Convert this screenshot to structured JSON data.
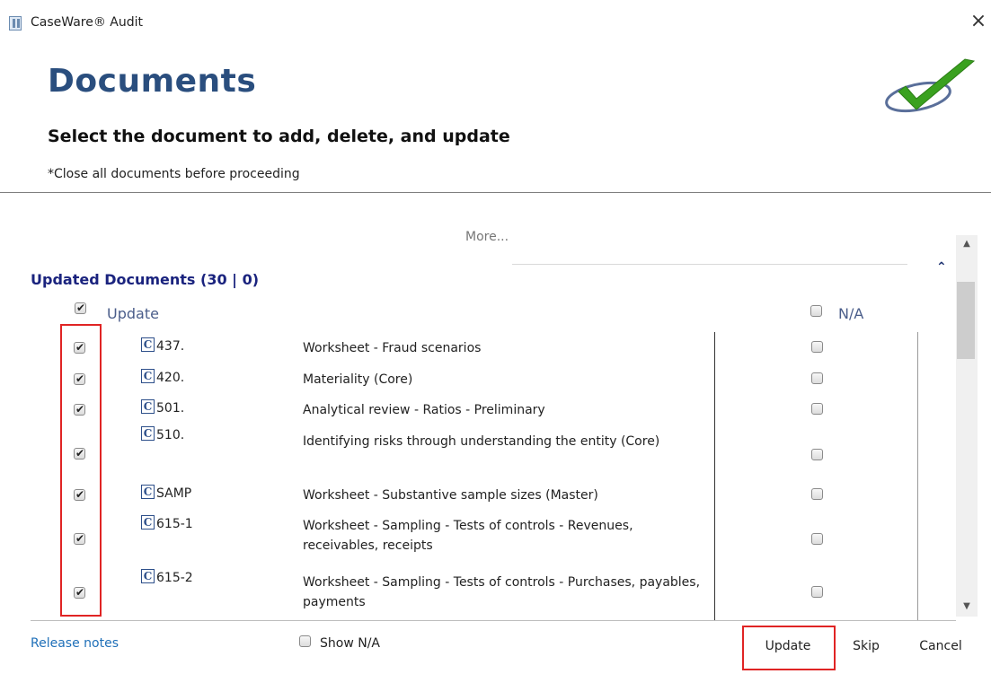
{
  "window": {
    "title": "CaseWare® Audit",
    "close_glyph": "×"
  },
  "header": {
    "title": "Documents",
    "subtitle": "Select the document to add, delete, and update",
    "note": "*Close all documents before proceeding"
  },
  "more_label": "More...",
  "section": {
    "title": "Updated Documents (30 | 0)",
    "update_header": "Update",
    "na_header": "N/A",
    "update_all_checked": true,
    "na_all_checked": false
  },
  "documents": [
    {
      "code": "437.",
      "description": "Worksheet - Fraud scenarios",
      "update": true,
      "na": false
    },
    {
      "code": "420.",
      "description": "Materiality (Core)",
      "update": true,
      "na": false
    },
    {
      "code": "501.",
      "description": "Analytical review - Ratios - Preliminary",
      "update": true,
      "na": false
    },
    {
      "code": "510.",
      "description": "Identifying risks through understanding the entity (Core)",
      "update": true,
      "na": false
    },
    {
      "code": "SAMP",
      "description": "Worksheet - Substantive sample sizes (Master)",
      "update": true,
      "na": false
    },
    {
      "code": "615-1",
      "description": "Worksheet - Sampling - Tests of controls - Revenues, receivables, receipts",
      "update": true,
      "na": false
    },
    {
      "code": "615-2",
      "description": "Worksheet - Sampling - Tests of controls - Purchases, payables, payments",
      "update": true,
      "na": false
    }
  ],
  "doc_icon_letter": "C",
  "footer": {
    "release_notes": "Release notes",
    "show_na_label": "Show N/A",
    "show_na_checked": false,
    "update_button": "Update",
    "skip_button": "Skip",
    "cancel_button": "Cancel"
  },
  "icons": {
    "app": "app-icon",
    "logo": "checkmark-swoosh-logo",
    "doc": "caseware-document-icon",
    "collapse": "chevron-up-icon",
    "scroll_up": "scroll-up-arrow-icon",
    "scroll_down": "scroll-down-arrow-icon"
  },
  "colors": {
    "title_blue": "#2a4e7e",
    "section_navy": "#1a237e",
    "link_blue": "#1e6fb8",
    "highlight_red": "#e02424",
    "logo_green": "#3aa11f"
  }
}
